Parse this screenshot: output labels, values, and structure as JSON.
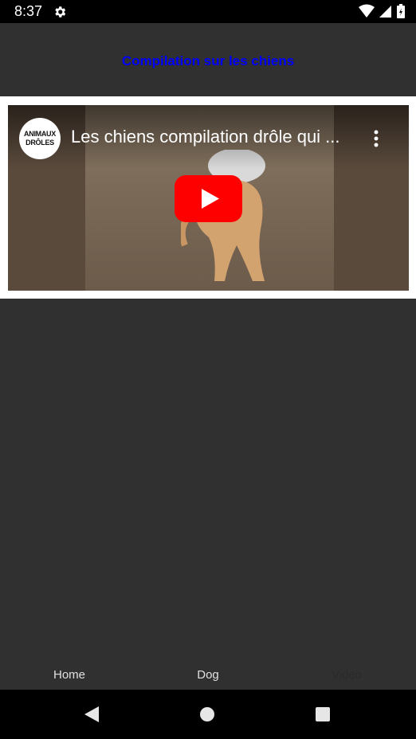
{
  "status_bar": {
    "time": "8:37",
    "icons": [
      "gear-icon",
      "wifi-icon",
      "cell-signal-icon",
      "battery-icon"
    ]
  },
  "header": {
    "title": "Compilation sur les chiens"
  },
  "video": {
    "title": "Les chiens compilation drôle qui ...",
    "channel_logo_line1": "ANIMAUX",
    "channel_logo_line2": "DRÔLES",
    "play_icon": "youtube-play-icon",
    "menu_icon": "kebab-icon"
  },
  "bottom_nav": {
    "items": [
      {
        "label": "Home",
        "active": false
      },
      {
        "label": "Dog",
        "active": false
      },
      {
        "label": "Video",
        "active": true
      }
    ]
  },
  "system_nav": {
    "icons": [
      "back-icon",
      "home-icon",
      "recents-icon"
    ]
  },
  "colors": {
    "title_blue": "#0000ff",
    "background": "#303030",
    "youtube_red": "#ff0000"
  }
}
